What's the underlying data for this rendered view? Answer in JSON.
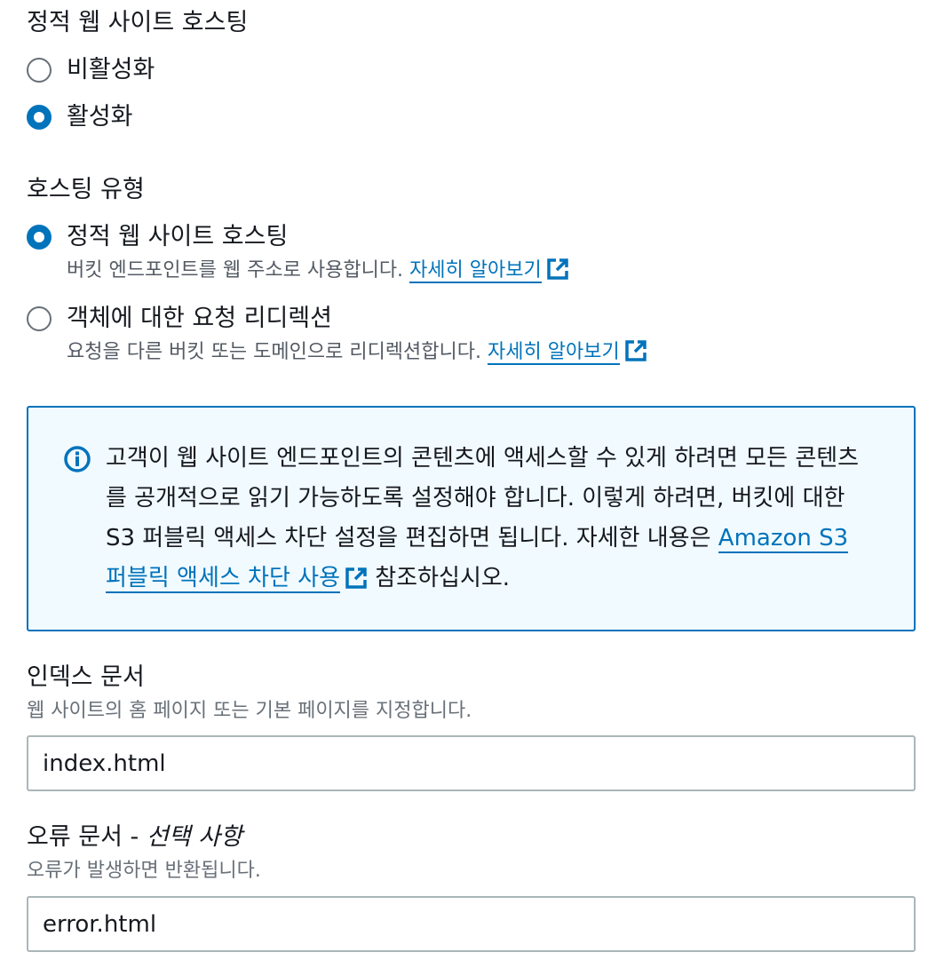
{
  "hosting": {
    "title": "정적 웹 사이트 호스팅",
    "options": [
      {
        "label": "비활성화",
        "selected": false
      },
      {
        "label": "활성화",
        "selected": true
      }
    ]
  },
  "hosting_type": {
    "title": "호스팅 유형",
    "options": [
      {
        "label": "정적 웹 사이트 호스팅",
        "description": "버킷 엔드포인트를 웹 주소로 사용합니다.",
        "link": "자세히 알아보기",
        "selected": true
      },
      {
        "label": "객체에 대한 요청 리디렉션",
        "description": "요청을 다른 버킷 또는 도메인으로 리디렉션합니다.",
        "link": "자세히 알아보기",
        "selected": false
      }
    ]
  },
  "info": {
    "text_before": "고객이 웹 사이트 엔드포인트의 콘텐츠에 액세스할 수 있게 하려면 모든 콘텐츠를 공개적으로 읽기 가능하도록 설정해야 합니다. 이렇게 하려면, 버킷에 대한 S3 퍼블릭 액세스 차단 설정을 편집하면 됩니다. 자세한 내용은",
    "link": "Amazon S3 퍼블릭 액세스 차단 사용",
    "text_after": "참조하십시오."
  },
  "index_document": {
    "label": "인덱스 문서",
    "description": "웹 사이트의 홈 페이지 또는 기본 페이지를 지정합니다.",
    "value": "index.html"
  },
  "error_document": {
    "label": "오류 문서",
    "label_suffix": "선택 사항",
    "description": "오류가 발생하면 반환됩니다.",
    "value": "error.html"
  },
  "colors": {
    "accent": "#0073bb",
    "info_background": "#f1faff",
    "text": "#16191f",
    "secondary_text": "#545b64"
  }
}
